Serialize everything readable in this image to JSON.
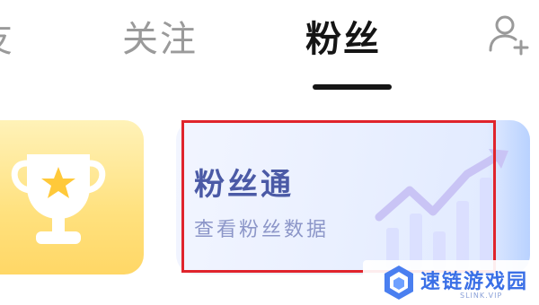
{
  "tabs": {
    "partial_label": "友",
    "follow_label": "关注",
    "fans_label": "粉丝",
    "active": "粉丝"
  },
  "header": {
    "add_user_icon": "add-user-icon"
  },
  "cards": {
    "trophy": {
      "icon": "trophy-icon",
      "accent": "#ffd766"
    },
    "fans_pass": {
      "title": "粉丝通",
      "subtitle": "查看粉丝数据",
      "icon": "growth-chart-icon",
      "accent": "#4b5aa6",
      "highlighted": true,
      "highlight_color": "#e0242c"
    }
  },
  "watermark": {
    "name": "速链游戏园",
    "url": "SLINK.VIP",
    "brand_color": "#3a6fe6"
  }
}
